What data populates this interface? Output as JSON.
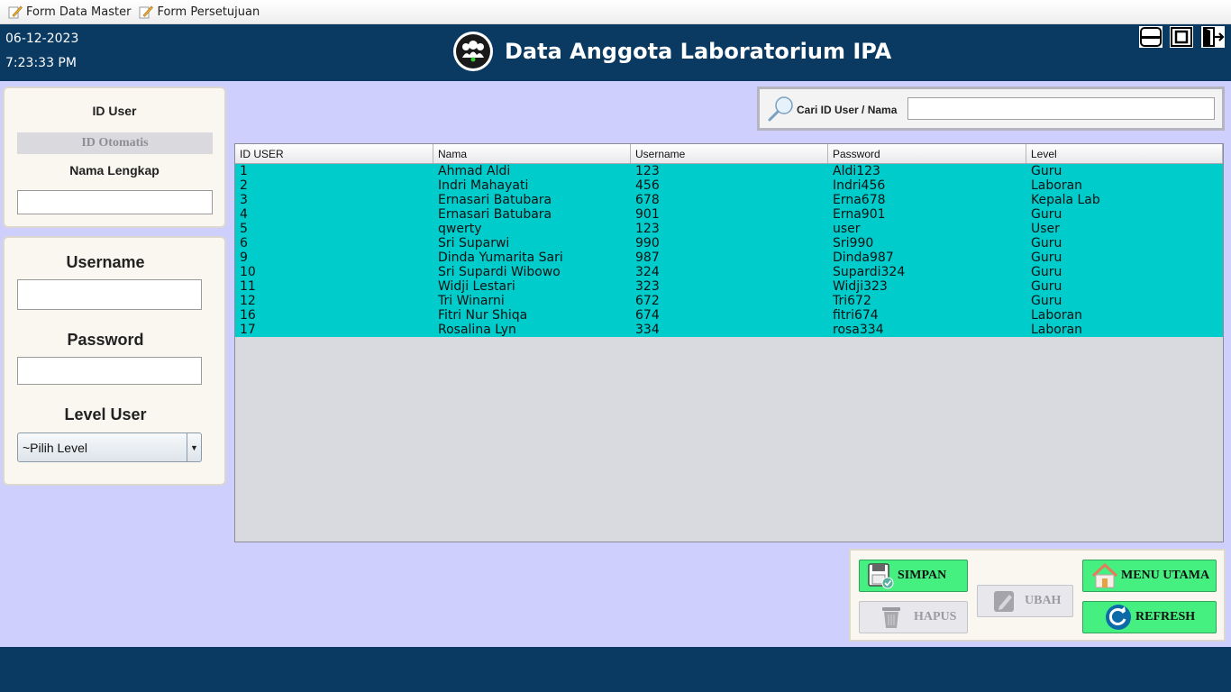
{
  "menubar": {
    "items": [
      {
        "label": "Form Data Master",
        "icon": "pencil-note-icon"
      },
      {
        "label": "Form Persetujuan",
        "icon": "pencil-note-icon"
      }
    ]
  },
  "header": {
    "date": "06-12-2023",
    "time": "7:23:33 PM",
    "title": "Data Anggota Laboratorium IPA",
    "window_buttons": [
      "minimize-icon",
      "maximize-icon",
      "exit-icon"
    ]
  },
  "form": {
    "id_user_label": "ID User",
    "id_placeholder": "ID Otomatis",
    "nama_lengkap_label": "Nama Lengkap",
    "nama_lengkap_value": "",
    "username_label": "Username",
    "username_value": "",
    "password_label": "Password",
    "password_value": "",
    "level_label": "Level User",
    "level_selected": "~Pilih Level"
  },
  "search": {
    "label": "Cari ID User / Nama",
    "value": ""
  },
  "table": {
    "columns": [
      "ID USER",
      "Nama",
      "Username",
      "Password",
      "Level"
    ],
    "rows": [
      [
        "1",
        "Ahmad Aldi",
        "123",
        "Aldi123",
        "Guru"
      ],
      [
        "2",
        "Indri Mahayati",
        "456",
        "Indri456",
        "Laboran"
      ],
      [
        "3",
        "Ernasari Batubara",
        "678",
        "Erna678",
        "Kepala Lab"
      ],
      [
        "4",
        "Ernasari Batubara",
        "901",
        "Erna901",
        "Guru"
      ],
      [
        "5",
        "qwerty",
        "123",
        "user",
        "User"
      ],
      [
        "6",
        "Sri Suparwi",
        "990",
        "Sri990",
        "Guru"
      ],
      [
        "9",
        "Dinda Yumarita Sari",
        "987",
        "Dinda987",
        "Guru"
      ],
      [
        "10",
        "Sri Supardi Wibowo",
        "324",
        "Supardi324",
        "Guru"
      ],
      [
        "11",
        "Widji Lestari",
        "323",
        "Widji323",
        "Guru"
      ],
      [
        "12",
        "Tri Winarni",
        "672",
        "Tri672",
        "Guru"
      ],
      [
        "16",
        "Fitri Nur Shiqa",
        "674",
        "fitri674",
        "Laboran"
      ],
      [
        "17",
        "Rosalina Lyn",
        "334",
        "rosa334",
        "Laboran"
      ]
    ]
  },
  "buttons": {
    "simpan": "SIMPAN",
    "hapus": "HAPUS",
    "ubah": "UBAH",
    "menu_utama": "MENU UTAMA",
    "refresh": "REFRESH"
  },
  "colors": {
    "header_bg": "#0a3a62",
    "page_bg": "#cfcffd",
    "row_bg": "#00cccc",
    "button_green": "#45ef80"
  }
}
